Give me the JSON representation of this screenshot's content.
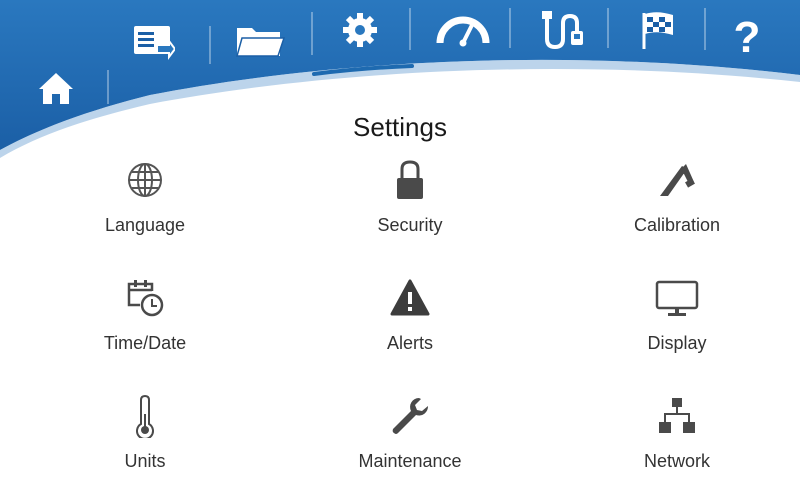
{
  "header": {
    "nav": [
      {
        "id": "home",
        "icon": "home-icon"
      },
      {
        "id": "screen",
        "icon": "screen-export-icon"
      },
      {
        "id": "files",
        "icon": "folder-icon"
      },
      {
        "id": "settings",
        "icon": "gear-icon",
        "active": true
      },
      {
        "id": "gauge",
        "icon": "speedometer-icon"
      },
      {
        "id": "usb",
        "icon": "usb-cable-icon"
      },
      {
        "id": "flag",
        "icon": "checkered-flag-icon"
      },
      {
        "id": "help",
        "icon": "help-icon",
        "glyph": "?"
      }
    ],
    "colors": {
      "banner": "#1e6ab0",
      "banner_light": "#3a86c8",
      "active_underline": "#1e6ab0"
    }
  },
  "page": {
    "title": "Settings"
  },
  "tiles": [
    {
      "label": "Language",
      "icon": "globe-icon"
    },
    {
      "label": "Security",
      "icon": "padlock-icon"
    },
    {
      "label": "Calibration",
      "icon": "caliper-icon"
    },
    {
      "label": "Time/Date",
      "icon": "calendar-clock-icon"
    },
    {
      "label": "Alerts",
      "icon": "warning-icon"
    },
    {
      "label": "Display",
      "icon": "monitor-icon"
    },
    {
      "label": "Units",
      "icon": "thermometer-icon"
    },
    {
      "label": "Maintenance",
      "icon": "wrench-icon"
    },
    {
      "label": "Network",
      "icon": "network-icon"
    }
  ]
}
